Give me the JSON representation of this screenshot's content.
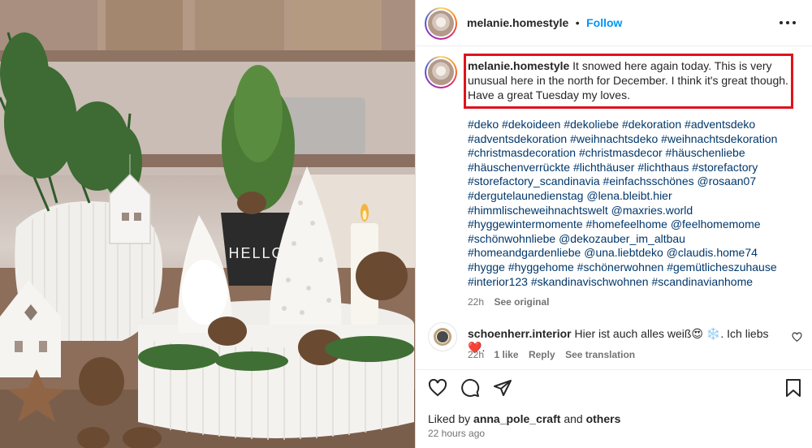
{
  "post": {
    "username": "melanie.homestyle",
    "separator": "•",
    "follow_label": "Follow",
    "more_icon": "more-options-icon"
  },
  "caption": {
    "username": "melanie.homestyle",
    "text": "It snowed here again today. This is very unusual here in the north for December. I think it's great though. Have a great Tuesday my loves.",
    "hashtags": [
      "#deko",
      "#dekoideen",
      "#dekoliebe",
      "#dekoration",
      "#adventsdeko",
      "#adventsdekoration",
      "#weihnachtsdeko",
      "#weihnachtsdekoration",
      "#christmasdecoration",
      "#christmasdecor",
      "#häuschenliebe",
      "#häuschenverrückte",
      "#lichthäuser",
      "#lichthaus",
      "#storefactory",
      "#storefactory_scandinavia",
      "#einfachsschönes",
      "@rosaan07",
      "#dergutelaunedienstag",
      "@lena.bleibt.hier",
      "#himmlischeweihnachtswelt",
      "@maxries.world",
      "#hyggewintermomente",
      "#homefeelhome",
      "@feelhomemome",
      "#schönwohnliebe",
      "@dekozauber_im_altbau",
      "#homeandgardenliebe",
      "@una.liebtdeko",
      "@claudis.home74",
      "#hygge",
      "#hyggehome",
      "#schönerwohnen",
      "#gemütlicheszuhause",
      "#interior123",
      "#skandinavischwohnen",
      "#scandinavianhome"
    ],
    "time": "22h",
    "see_original": "See original",
    "highlight_color": "#e0121c"
  },
  "comment": {
    "username": "schoenherr.interior",
    "text_before": "Hier ist auch alles weiß",
    "emoji_1": "😍",
    "emoji_2": "❄️",
    "text_after": ". Ich liebs",
    "emoji_3": "❤️",
    "text_end": ".",
    "time": "22h",
    "likes": "1 like",
    "reply": "Reply",
    "translate": "See translation"
  },
  "actions": {
    "like_icon": "heart-icon",
    "comment_icon": "comment-icon",
    "share_icon": "share-icon",
    "save_icon": "bookmark-icon"
  },
  "likes": {
    "prefix": "Liked by",
    "user": "anna_pole_craft",
    "and": "and",
    "others": "others"
  },
  "timestamp": "22 hours ago",
  "photo": {
    "mug_text": "HELLO"
  },
  "colors": {
    "link": "#00376b",
    "follow": "#0095f6",
    "muted": "#737373",
    "text": "#262626",
    "heart_red": "#ed4956"
  }
}
